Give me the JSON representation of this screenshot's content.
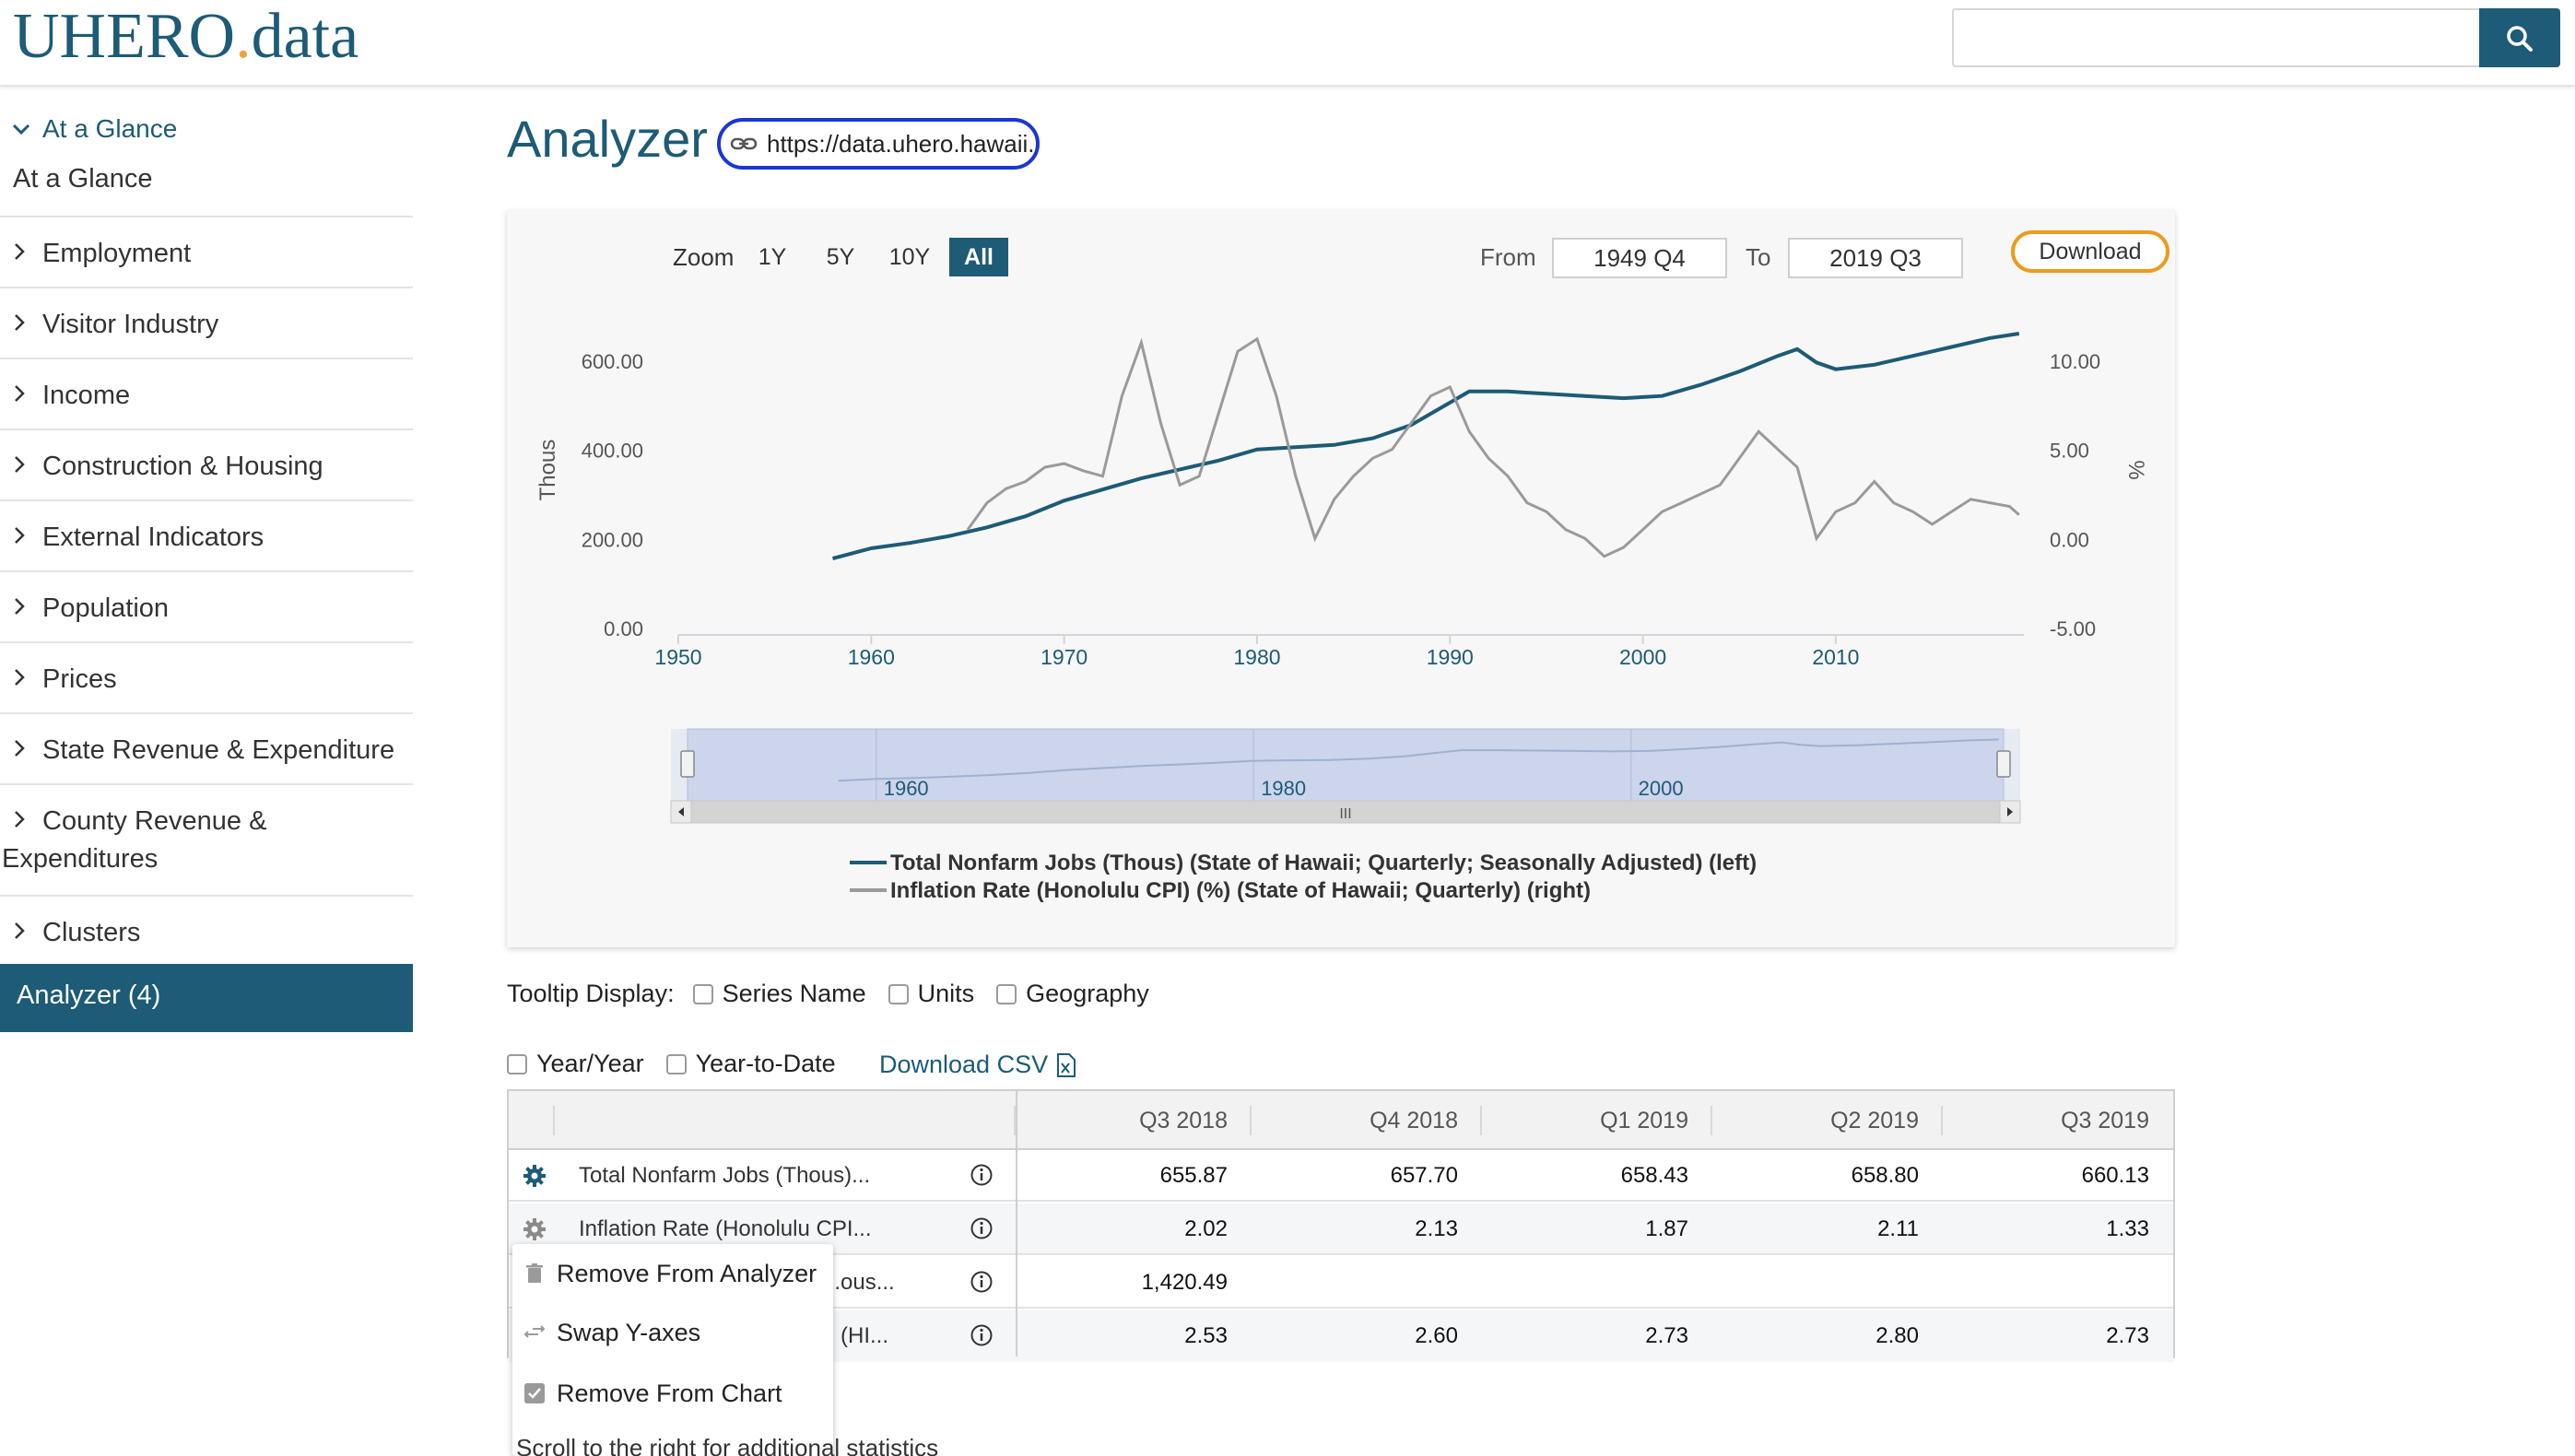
{
  "header": {
    "logo_main": "UHERO",
    "logo_dot": ".",
    "logo_suffix": "data",
    "search_placeholder": ""
  },
  "sidebar": {
    "section_title": "At a Glance",
    "section_sub": "At a Glance",
    "items": [
      {
        "label": "Employment"
      },
      {
        "label": "Visitor Industry"
      },
      {
        "label": "Income"
      },
      {
        "label": "Construction & Housing"
      },
      {
        "label": "External Indicators"
      },
      {
        "label": "Population"
      },
      {
        "label": "Prices"
      },
      {
        "label": "State Revenue & Expenditure"
      },
      {
        "label": "County Revenue &",
        "label2": "Expenditures"
      },
      {
        "label": "Clusters"
      }
    ],
    "active_item": "Analyzer (4)"
  },
  "main": {
    "title": "Analyzer",
    "url_value": "https://data.uhero.hawaii.edu/"
  },
  "chart_controls": {
    "zoom_label": "Zoom",
    "zoom_options": [
      "1Y",
      "5Y",
      "10Y",
      "All"
    ],
    "zoom_active": "All",
    "from_label": "From",
    "from_value": "1949 Q4",
    "to_label": "To",
    "to_value": "2019 Q3",
    "download_label": "Download"
  },
  "chart_data": {
    "type": "line",
    "title": "",
    "xlabel": "",
    "ylabel_left": "Thous",
    "ylabel_right": "%",
    "x_ticks": [
      "1950",
      "1960",
      "1970",
      "1980",
      "1990",
      "2000",
      "2010"
    ],
    "xlim": [
      1950,
      2019.75
    ],
    "y_left_ticks": [
      "0.00",
      "200.00",
      "400.00",
      "600.00"
    ],
    "y_left_lim": [
      0,
      600
    ],
    "y_right_ticks": [
      "-5.00",
      "0.00",
      "5.00",
      "10.00"
    ],
    "y_right_lim": [
      -5,
      10
    ],
    "navigator_ticks": [
      "1960",
      "1980",
      "2000"
    ],
    "navigator_scrollbar_label": "III",
    "legend_position": "bottom",
    "colors": {
      "left_series": "#1d5b76",
      "right_series": "#9a9a9a"
    },
    "series": [
      {
        "name": "Total Nonfarm Jobs (Thous) (State of Hawaii; Quarterly; Seasonally Adjusted) (left)",
        "axis": "left",
        "x": [
          1958,
          1960,
          1962,
          1964,
          1966,
          1968,
          1970,
          1972,
          1974,
          1976,
          1978,
          1980,
          1982,
          1984,
          1986,
          1988,
          1990,
          1991,
          1993,
          1995,
          1997,
          1999,
          2001,
          2003,
          2005,
          2007,
          2008,
          2009,
          2010,
          2012,
          2014,
          2016,
          2018,
          2019.5
        ],
        "y": [
          155,
          178,
          190,
          205,
          225,
          250,
          285,
          310,
          335,
          355,
          375,
          400,
          405,
          410,
          425,
          455,
          505,
          530,
          530,
          525,
          520,
          515,
          520,
          545,
          575,
          610,
          625,
          595,
          580,
          590,
          610,
          630,
          650,
          660
        ]
      },
      {
        "name": "Inflation Rate (Honolulu CPI) (%) (State of Hawaii; Quarterly) (right)",
        "axis": "right",
        "x": [
          1965,
          1966,
          1967,
          1968,
          1969,
          1970,
          1971,
          1972,
          1973,
          1974,
          1975,
          1976,
          1977,
          1978,
          1979,
          1980,
          1981,
          1982,
          1983,
          1984,
          1985,
          1986,
          1987,
          1988,
          1989,
          1990,
          1991,
          1992,
          1993,
          1994,
          1995,
          1996,
          1997,
          1998,
          1999,
          2000,
          2001,
          2002,
          2003,
          2004,
          2005,
          2006,
          2007,
          2008,
          2009,
          2010,
          2011,
          2012,
          2013,
          2014,
          2015,
          2016,
          2017,
          2018,
          2019,
          2019.5
        ],
        "y": [
          0.5,
          2.0,
          2.8,
          3.2,
          4.0,
          4.2,
          3.8,
          3.5,
          8.0,
          11.0,
          6.5,
          3.0,
          3.5,
          7.0,
          10.5,
          11.2,
          8.0,
          3.5,
          0.0,
          2.2,
          3.5,
          4.5,
          5.0,
          6.5,
          8.0,
          8.5,
          6.0,
          4.5,
          3.5,
          2.0,
          1.5,
          0.5,
          0.0,
          -1.0,
          -0.5,
          0.5,
          1.5,
          2.0,
          2.5,
          3.0,
          4.5,
          6.0,
          5.0,
          4.0,
          0.0,
          1.5,
          2.0,
          3.2,
          2.0,
          1.5,
          0.8,
          1.5,
          2.2,
          2.0,
          1.8,
          1.33
        ]
      }
    ]
  },
  "tooltip_display": {
    "label": "Tooltip Display:",
    "options": [
      "Series Name",
      "Units",
      "Geography"
    ]
  },
  "table_options": {
    "year_year": "Year/Year",
    "year_to_date": "Year-to-Date",
    "download_csv": "Download CSV"
  },
  "table": {
    "columns": [
      "Q3 2018",
      "Q4 2018",
      "Q1 2019",
      "Q2 2019",
      "Q3 2019"
    ],
    "rows": [
      {
        "name": "Total Nonfarm Jobs (Thous)...",
        "values": [
          "655.87",
          "657.70",
          "658.43",
          "658.80",
          "660.13"
        ]
      },
      {
        "name": "Inflation Rate (Honolulu CPI...",
        "values": [
          "2.02",
          "2.13",
          "1.87",
          "2.11",
          "1.33"
        ]
      },
      {
        "name": "...ous...",
        "values": [
          "1,420.49",
          "",
          "",
          "",
          ""
        ]
      },
      {
        "name": "(HI...",
        "values": [
          "2.53",
          "2.60",
          "2.73",
          "2.80",
          "2.73"
        ]
      }
    ]
  },
  "context_menu": {
    "items": [
      "Remove From Analyzer",
      "Swap Y-axes",
      "Remove From Chart"
    ]
  },
  "footer_note": "Scroll to the right for additional statistics"
}
